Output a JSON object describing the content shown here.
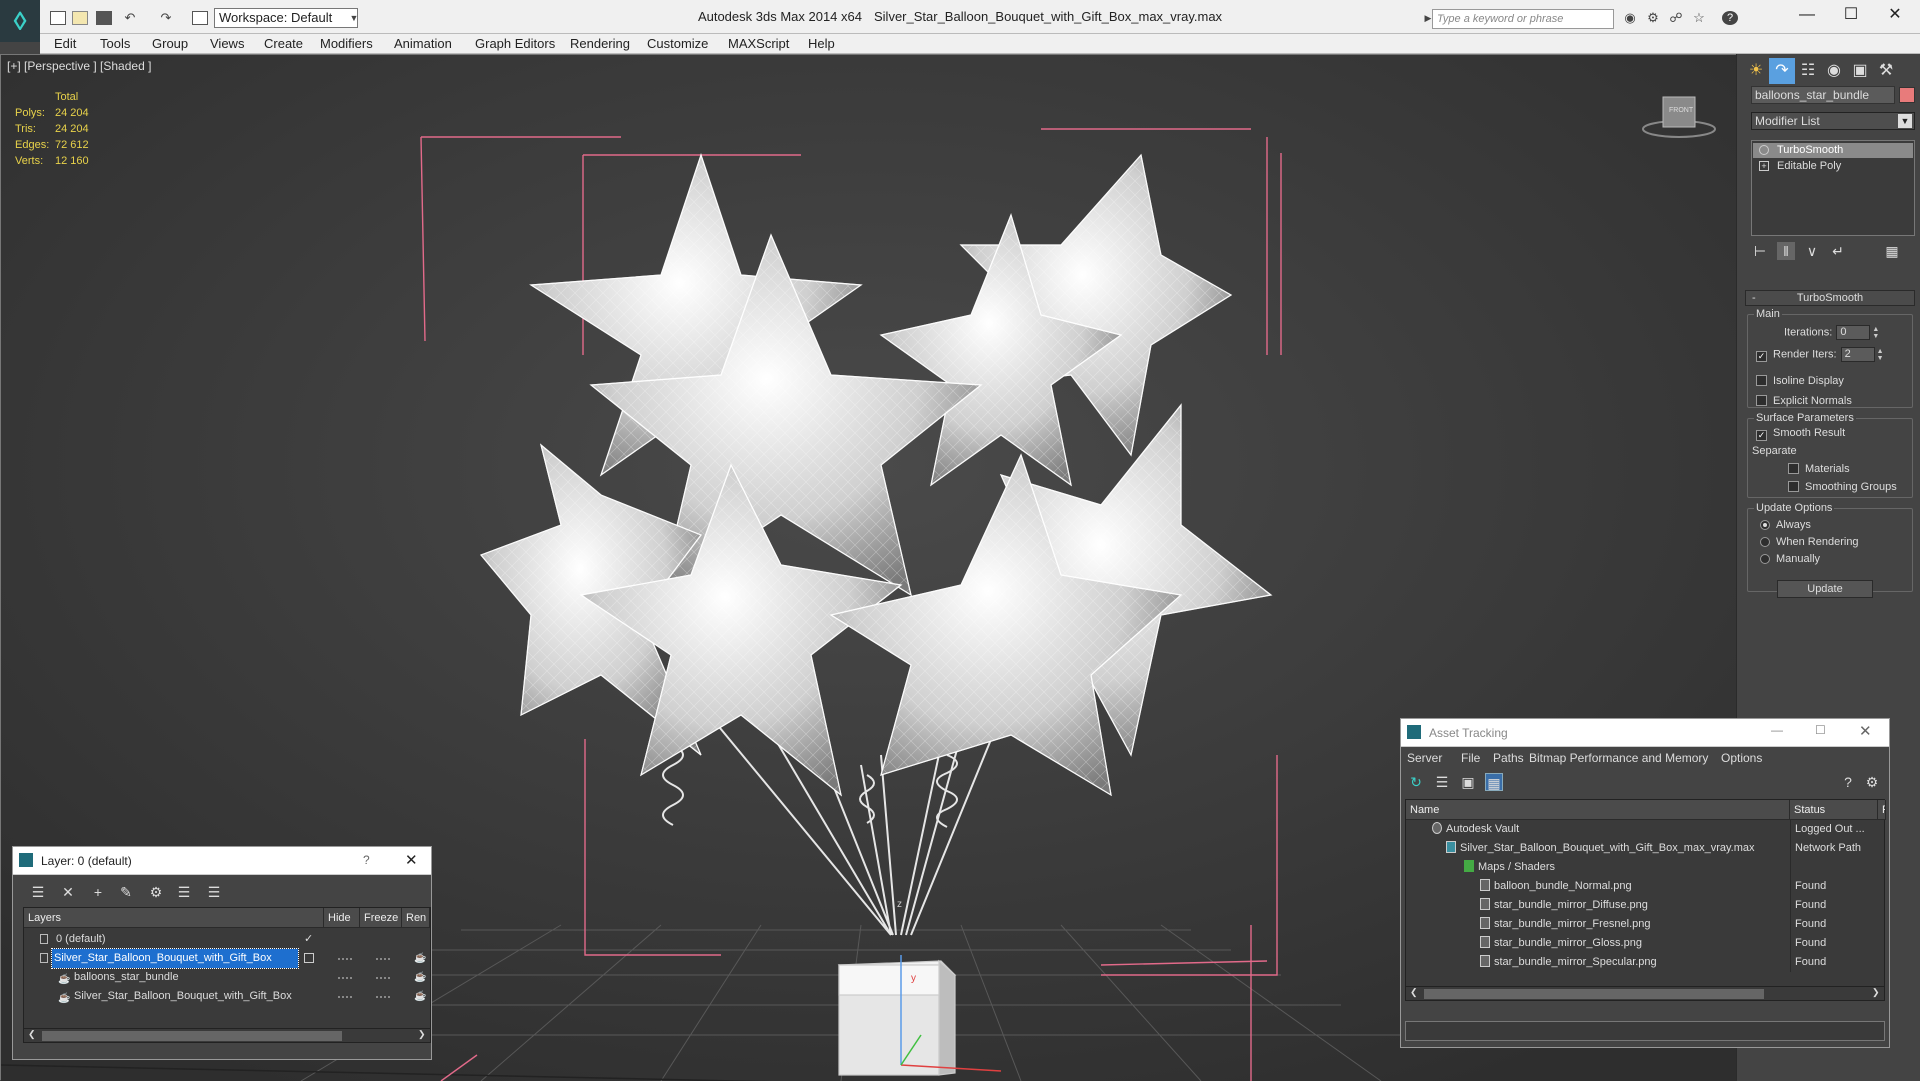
{
  "app": {
    "name": "Autodesk 3ds Max  2014 x64",
    "file": "Silver_Star_Balloon_Bouquet_with_Gift_Box_max_vray.max",
    "workspace": "Workspace: Default",
    "search_placeholder": "Type a keyword or phrase"
  },
  "menu": [
    "Edit",
    "Tools",
    "Group",
    "Views",
    "Create",
    "Modifiers",
    "Animation",
    "Graph Editors",
    "Rendering",
    "Customize",
    "MAXScript",
    "Help"
  ],
  "viewport": {
    "label": "[+] [Perspective ] [Shaded ]",
    "stats_header": "Total",
    "stats": [
      {
        "key": "Polys:",
        "value": "24 204"
      },
      {
        "key": "Tris:",
        "value": "24 204"
      },
      {
        "key": "Edges:",
        "value": "72 612"
      },
      {
        "key": "Verts:",
        "value": "12 160"
      }
    ],
    "viewcube_label": "FRONT",
    "axis_z": "z",
    "axis_y": "y"
  },
  "command_panel": {
    "object_name": "balloons_star_bundle",
    "object_color": "#e87b7b",
    "modifier_list": "Modifier List",
    "stack": [
      "TurboSmooth",
      "Editable Poly"
    ],
    "rollout_title": "TurboSmooth",
    "main_group": "Main",
    "iterations_label": "Iterations:",
    "iterations_value": "0",
    "render_iters_label": "Render Iters:",
    "render_iters_value": "2",
    "isoline_label": "Isoline Display",
    "explicit_normals_label": "Explicit Normals",
    "surface_group": "Surface Parameters",
    "smooth_result_label": "Smooth Result",
    "separate_label": "Separate",
    "materials_label": "Materials",
    "smoothing_groups_label": "Smoothing Groups",
    "update_group": "Update Options",
    "update_always": "Always",
    "update_when_rendering": "When Rendering",
    "update_manually": "Manually",
    "update_button": "Update"
  },
  "layer_window": {
    "title": "Layer: 0 (default)",
    "help": "?",
    "columns": [
      "Layers",
      "Hide",
      "Freeze",
      "Ren"
    ],
    "rows": [
      {
        "name": "0 (default)",
        "indent": 0
      },
      {
        "name": "Silver_Star_Balloon_Bouquet_with_Gift_Box",
        "indent": 0
      },
      {
        "name": "balloons_star_bundle",
        "indent": 1
      },
      {
        "name": "Silver_Star_Balloon_Bouquet_with_Gift_Box",
        "indent": 1
      }
    ]
  },
  "asset_window": {
    "title": "Asset Tracking",
    "menu": [
      "Server",
      "File",
      "Paths",
      "Bitmap Performance and Memory",
      "Options"
    ],
    "columns": [
      "Name",
      "Status",
      "Pr"
    ],
    "rows": [
      {
        "name": "Autodesk Vault",
        "status": "Logged Out ..."
      },
      {
        "name": "Silver_Star_Balloon_Bouquet_with_Gift_Box_max_vray.max",
        "status": "Network Path"
      },
      {
        "name": "Maps / Shaders",
        "status": ""
      },
      {
        "name": "balloon_bundle_Normal.png",
        "status": "Found"
      },
      {
        "name": "star_bundle_mirror_Diffuse.png",
        "status": "Found"
      },
      {
        "name": "star_bundle_mirror_Fresnel.png",
        "status": "Found"
      },
      {
        "name": "star_bundle_mirror_Gloss.png",
        "status": "Found"
      },
      {
        "name": "star_bundle_mirror_Specular.png",
        "status": "Found"
      }
    ]
  }
}
